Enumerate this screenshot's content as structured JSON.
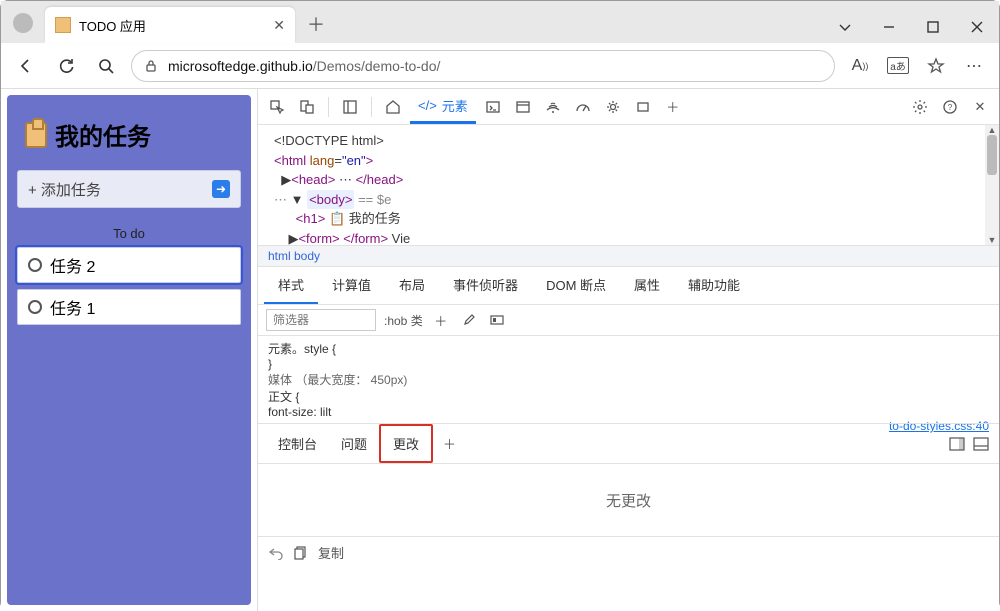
{
  "browser": {
    "tab_title": "TODO 应用",
    "url_prefix": "microsoftedge.github.io",
    "url_path": "/Demos/demo-to-do/"
  },
  "app": {
    "title": "我的任务",
    "add_label": "+ 添加任务",
    "section": "To do",
    "tasks": [
      {
        "label": "任务 2",
        "selected": true
      },
      {
        "label": "任务 1",
        "selected": false
      }
    ]
  },
  "devtools": {
    "elements_tab": "元素",
    "dom": {
      "doctype": "<!DOCTYPE html>",
      "html_open": "<html lang=\"en\">",
      "head": "<head> ⋯ </head>",
      "body": "<body>",
      "body_suffix": " == $e",
      "h1_text": "我的任务",
      "form": "<form> </form> Vie"
    },
    "crumbs": "html body",
    "side_tabs": [
      "样式",
      "计算值",
      "布局",
      "事件侦听器",
      "DOM 断点",
      "属性",
      "辅助功能"
    ],
    "filter_placeholder": "筛选器",
    "hov_label": ":hob 类",
    "styles": {
      "l1": "元素。style {",
      "l2": "}",
      "l3": "媒体  （最大宽度：    450px)",
      "l4": "正文 {",
      "l5": "  font-size: lilt",
      "link": "to-do-styles.css:40"
    },
    "drawer": {
      "tabs": [
        "控制台",
        "问题",
        "更改"
      ],
      "nochanges": "无更改",
      "copy": "复制"
    }
  }
}
